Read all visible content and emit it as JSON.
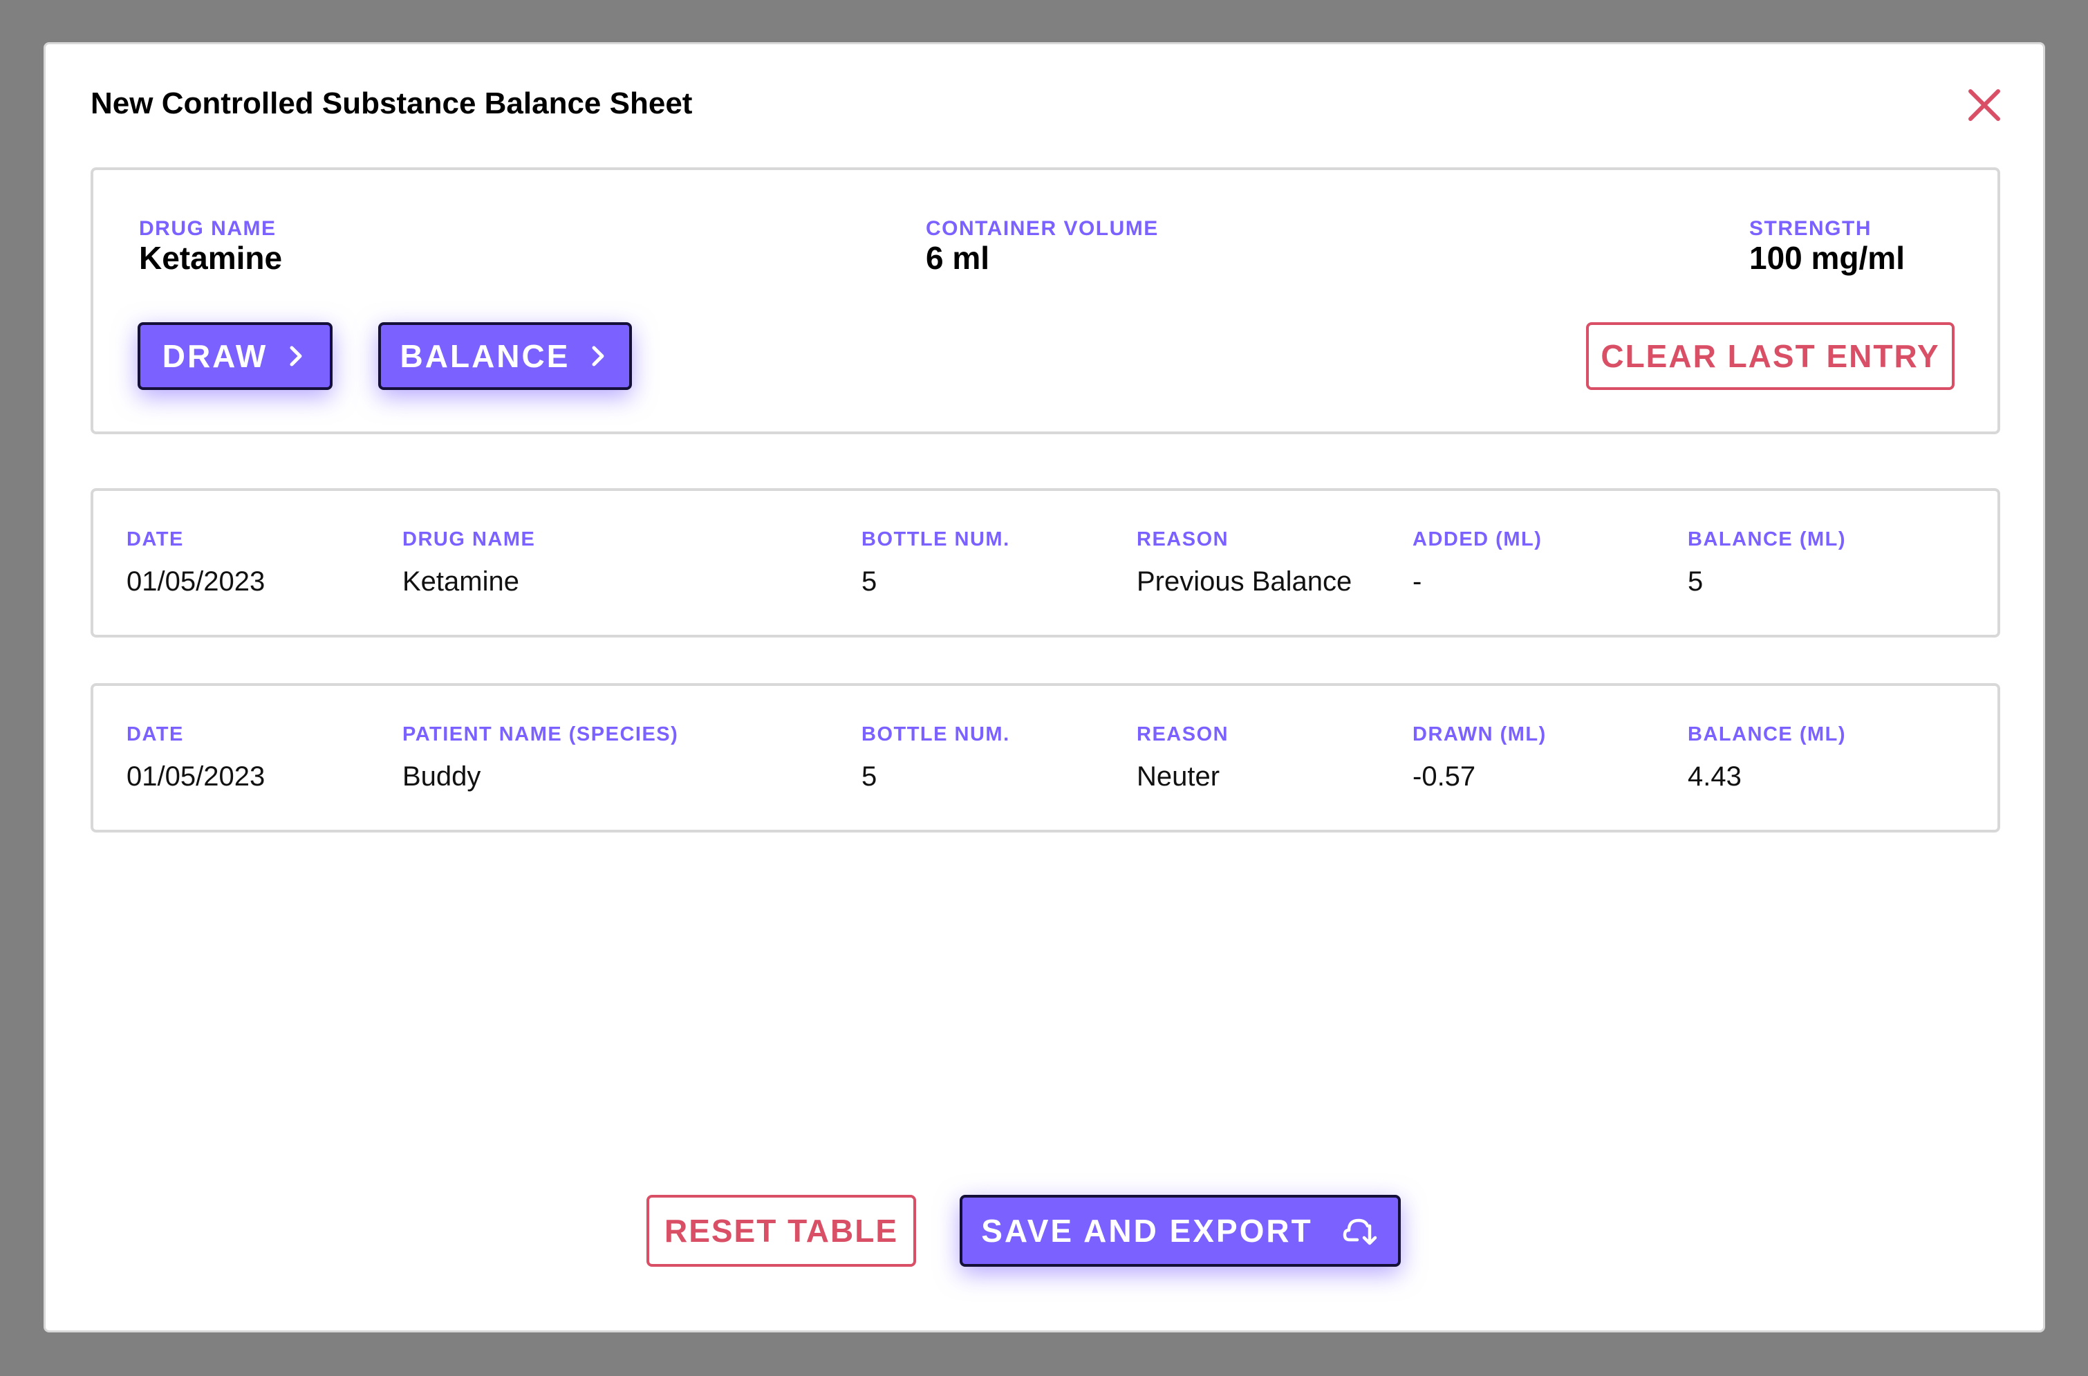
{
  "modal": {
    "title": "New Controlled Substance Balance Sheet"
  },
  "info": {
    "drug_name_label": "DRUG NAME",
    "drug_name": "Ketamine",
    "container_volume_label": "CONTAINER VOLUME",
    "container_volume": "6 ml",
    "strength_label": "STRENGTH",
    "strength": "100 mg/ml",
    "draw_label": "DRAW",
    "balance_label": "BALANCE",
    "clear_label": "CLEAR LAST ENTRY"
  },
  "rows": [
    {
      "headers": [
        "DATE",
        "DRUG NAME",
        "BOTTLE NUM.",
        "REASON",
        "ADDED (ML)",
        "BALANCE (ML)"
      ],
      "values": [
        "01/05/2023",
        "Ketamine",
        "5",
        "Previous Balance",
        "-",
        "5"
      ]
    },
    {
      "headers": [
        "DATE",
        "PATIENT NAME (SPECIES)",
        "BOTTLE NUM.",
        "REASON",
        "DRAWN (ML)",
        "BALANCE (ML)"
      ],
      "values": [
        "01/05/2023",
        "Buddy",
        "5",
        "Neuter",
        "-0.57",
        "4.43"
      ]
    }
  ],
  "footer": {
    "reset_label": "RESET TABLE",
    "save_label": "SAVE AND EXPORT"
  },
  "colors": {
    "accent": "#7b61ff",
    "danger": "#d94f66",
    "overlay": "#808080"
  },
  "icons": {
    "close": "close-icon",
    "chevron": "chevron-right-icon",
    "export": "export-icon"
  }
}
